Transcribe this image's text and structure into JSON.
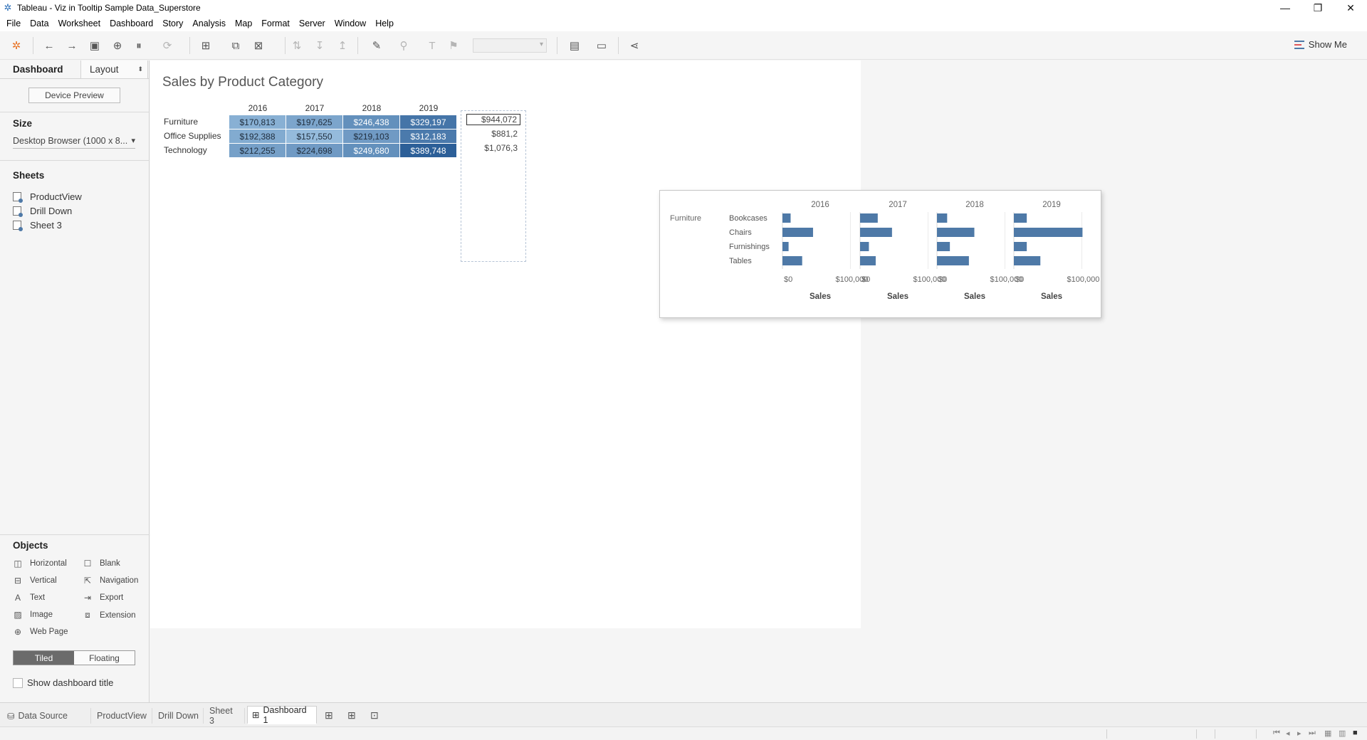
{
  "window": {
    "title": "Tableau - Viz in Tooltip Sample Data_Superstore"
  },
  "menu": [
    "File",
    "Data",
    "Worksheet",
    "Dashboard",
    "Story",
    "Analysis",
    "Map",
    "Format",
    "Server",
    "Window",
    "Help"
  ],
  "toolbar": {
    "show_me": "Show Me"
  },
  "left_panel": {
    "tab_dashboard": "Dashboard",
    "tab_layout": "Layout",
    "device_preview": "Device Preview",
    "size_heading": "Size",
    "size_value": "Desktop Browser (1000 x 8...",
    "sheets_heading": "Sheets",
    "sheets": [
      "ProductView",
      "Drill Down",
      "Sheet 3"
    ],
    "objects_heading": "Objects",
    "objects": [
      {
        "label": "Horizontal",
        "icon": "horizontal-container-icon"
      },
      {
        "label": "Blank",
        "icon": "blank-icon"
      },
      {
        "label": "Vertical",
        "icon": "vertical-container-icon"
      },
      {
        "label": "Navigation",
        "icon": "navigation-icon"
      },
      {
        "label": "Text",
        "icon": "text-icon"
      },
      {
        "label": "Export",
        "icon": "export-icon"
      },
      {
        "label": "Image",
        "icon": "image-icon"
      },
      {
        "label": "Extension",
        "icon": "extension-icon"
      },
      {
        "label": "Web Page",
        "icon": "web-page-icon"
      }
    ],
    "tiled": "Tiled",
    "floating": "Floating",
    "show_title": "Show dashboard title"
  },
  "dashboard": {
    "title": "Sales by Product Category",
    "years": [
      "2016",
      "2017",
      "2018",
      "2019"
    ],
    "rows": [
      {
        "category": "Furniture",
        "values": [
          "$170,813",
          "$197,625",
          "$246,438",
          "$329,197"
        ],
        "shade": [
          0.25,
          0.35,
          0.55,
          0.8
        ],
        "total": "$944,072"
      },
      {
        "category": "Office Supplies",
        "values": [
          "$192,388",
          "$157,550",
          "$219,103",
          "$312,183"
        ],
        "shade": [
          0.3,
          0.15,
          0.45,
          0.75
        ],
        "total": "$881,2"
      },
      {
        "category": "Technology",
        "values": [
          "$212,255",
          "$224,698",
          "$249,680",
          "$389,748"
        ],
        "shade": [
          0.4,
          0.45,
          0.55,
          1.0
        ],
        "total": "$1,076,3"
      }
    ],
    "heat_colors": {
      "light": "#a7cbe8",
      "dark": "#2c5f98"
    }
  },
  "chart_data": {
    "type": "bar",
    "orientation": "horizontal",
    "title": "",
    "row_header": "Furniture",
    "categories": [
      "Bookcases",
      "Chairs",
      "Furnishings",
      "Tables"
    ],
    "panels": [
      "2016",
      "2017",
      "2018",
      "2019"
    ],
    "series": [
      {
        "name": "2016",
        "values": [
          12000,
          45000,
          9000,
          29000
        ]
      },
      {
        "name": "2017",
        "values": [
          26000,
          47000,
          13000,
          23000
        ]
      },
      {
        "name": "2018",
        "values": [
          15000,
          55000,
          19000,
          47000
        ]
      },
      {
        "name": "2019",
        "values": [
          19000,
          101000,
          19000,
          39000
        ]
      }
    ],
    "xlabel": "Sales",
    "x_ticks": [
      "$0",
      "$100,000"
    ],
    "xlim": [
      0,
      110000
    ],
    "bar_color": "#4e79a7"
  },
  "bottom_tabs": [
    "Data Source",
    "ProductView",
    "Drill Down",
    "Sheet 3",
    "Dashboard 1"
  ]
}
